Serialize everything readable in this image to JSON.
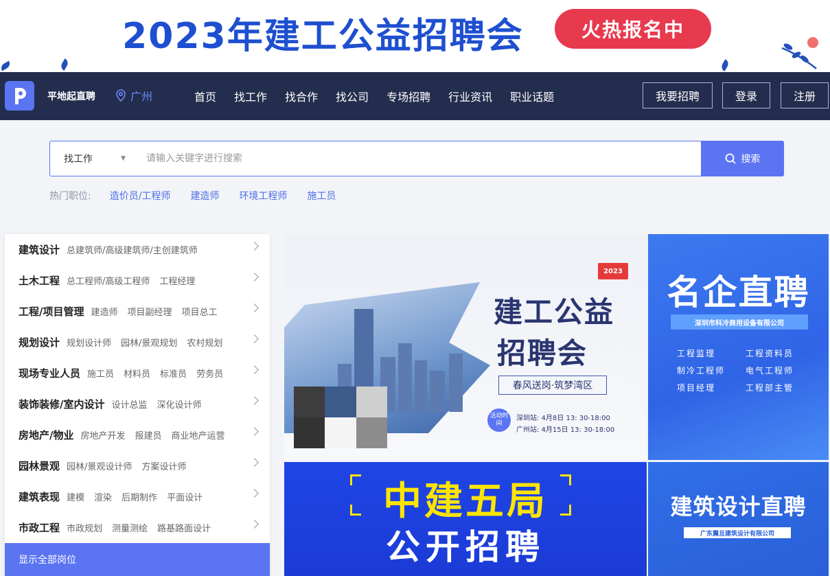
{
  "banner": {
    "title": "2023年建工公益招聘会",
    "badge": "火热报名中"
  },
  "nav": {
    "brand": "平地起直聘",
    "city": "广州",
    "links": [
      "首页",
      "找工作",
      "找合作",
      "找公司",
      "专场招聘",
      "行业资讯",
      "职业话题"
    ],
    "post_job": "我要招聘",
    "login": "登录",
    "register": "注册"
  },
  "search": {
    "type": "找工作",
    "placeholder": "请输入关键字进行搜索",
    "button": "搜索"
  },
  "hot": {
    "label": "热门职位:",
    "items": [
      "造价员/工程师",
      "建造师",
      "环境工程师",
      "施工员"
    ]
  },
  "categories": [
    {
      "name": "建筑设计",
      "subs": [
        "总建筑师/高级建筑师/主创建筑师"
      ]
    },
    {
      "name": "土木工程",
      "subs": [
        "总工程师/高级工程师",
        "工程经理"
      ]
    },
    {
      "name": "工程/项目管理",
      "subs": [
        "建造师",
        "项目副经理",
        "项目总工"
      ]
    },
    {
      "name": "规划设计",
      "subs": [
        "规划设计师",
        "园林/景观规划",
        "农村规划"
      ]
    },
    {
      "name": "现场专业人员",
      "subs": [
        "施工员",
        "材料员",
        "标准员",
        "劳务员"
      ]
    },
    {
      "name": "装饰装修/室内设计",
      "subs": [
        "设计总监",
        "深化设计师"
      ]
    },
    {
      "name": "房地产/物业",
      "subs": [
        "房地产开发",
        "报建员",
        "商业地产运营"
      ]
    },
    {
      "name": "园林景观",
      "subs": [
        "园林/景观设计师",
        "方案设计师"
      ]
    },
    {
      "name": "建筑表现",
      "subs": [
        "建模",
        "渲染",
        "后期制作",
        "平面设计"
      ]
    },
    {
      "name": "市政工程",
      "subs": [
        "市政规划",
        "测量测绘",
        "路基路面设计"
      ]
    }
  ],
  "show_all": "显示全部岗位",
  "ad_main": {
    "year_badge": "2023",
    "title_line1": "建工公益",
    "title_line2": "招聘会",
    "slogan": "春风送岗·筑梦湾区",
    "activity_label": "活动时间",
    "sessions": [
      "深圳站: 4月8日 13: 30-18:00",
      "广州站: 4月15日 13: 30-18:00"
    ]
  },
  "ad_right_top": {
    "title": "名企直聘",
    "company": "深圳市科冷商用设备有限公司",
    "jobs": [
      "工程监理",
      "工程资料员",
      "制冷工程师",
      "电气工程师",
      "项目经理",
      "工程部主管"
    ]
  },
  "ad_bottom_left": {
    "line1": "中建五局",
    "line2": "公开招聘"
  },
  "ad_bottom_right": {
    "title": "建筑设计直聘",
    "company": "广东震旦建筑设计有限公司"
  },
  "colors": {
    "accent": "#5b74f2",
    "nav_bg": "#232d4d",
    "banner_title": "#1e4fd0",
    "badge_red": "#e83a4f"
  }
}
